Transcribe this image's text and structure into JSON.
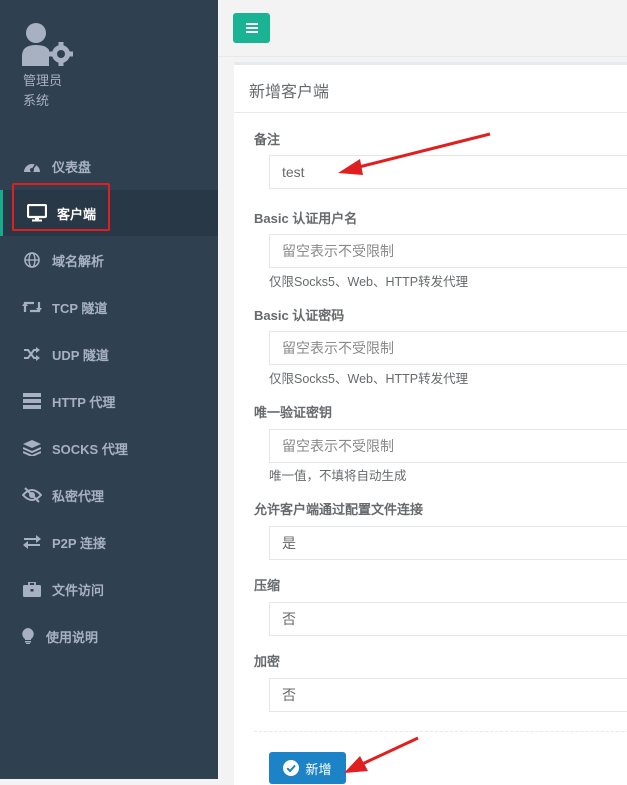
{
  "sidebar": {
    "profile": {
      "line1": "管理员",
      "line2": "系统",
      "icon": "user-cog-icon"
    },
    "items": [
      {
        "label": "仪表盘",
        "icon": "dashboard-icon"
      },
      {
        "label": "客户端",
        "icon": "desktop-icon",
        "active": true
      },
      {
        "label": "域名解析",
        "icon": "globe-icon"
      },
      {
        "label": "TCP 隧道",
        "icon": "retweet-icon"
      },
      {
        "label": "UDP 隧道",
        "icon": "random-icon"
      },
      {
        "label": "HTTP 代理",
        "icon": "server-icon"
      },
      {
        "label": "SOCKS 代理",
        "icon": "layers-icon"
      },
      {
        "label": "私密代理",
        "icon": "eye-slash-icon"
      },
      {
        "label": "P2P 连接",
        "icon": "exchange-icon"
      },
      {
        "label": "文件访问",
        "icon": "briefcase-icon"
      },
      {
        "label": "使用说明",
        "icon": "lightbulb-icon"
      }
    ]
  },
  "topbar": {
    "menu_icon": "hamburger-icon"
  },
  "panel": {
    "title": "新增客户端",
    "fields": {
      "remark": {
        "label": "备注",
        "value": "test"
      },
      "basic_user": {
        "label": "Basic 认证用户名",
        "placeholder": "留空表示不受限制",
        "help": "仅限Socks5、Web、HTTP转发代理"
      },
      "basic_pass": {
        "label": "Basic 认证密码",
        "placeholder": "留空表示不受限制",
        "help": "仅限Socks5、Web、HTTP转发代理"
      },
      "vkey": {
        "label": "唯一验证密钥",
        "placeholder": "留空表示不受限制",
        "help": "唯一值，不填将自动生成"
      },
      "config_conn": {
        "label": "允许客户端通过配置文件连接",
        "value": "是"
      },
      "compress": {
        "label": "压缩",
        "value": "否"
      },
      "crypt": {
        "label": "加密",
        "value": "否"
      }
    },
    "submit_label": "新增"
  },
  "colors": {
    "sidebar_bg": "#2f4050",
    "accent": "#1ab394",
    "button": "#1c84c6",
    "annotation": "#e02020"
  }
}
